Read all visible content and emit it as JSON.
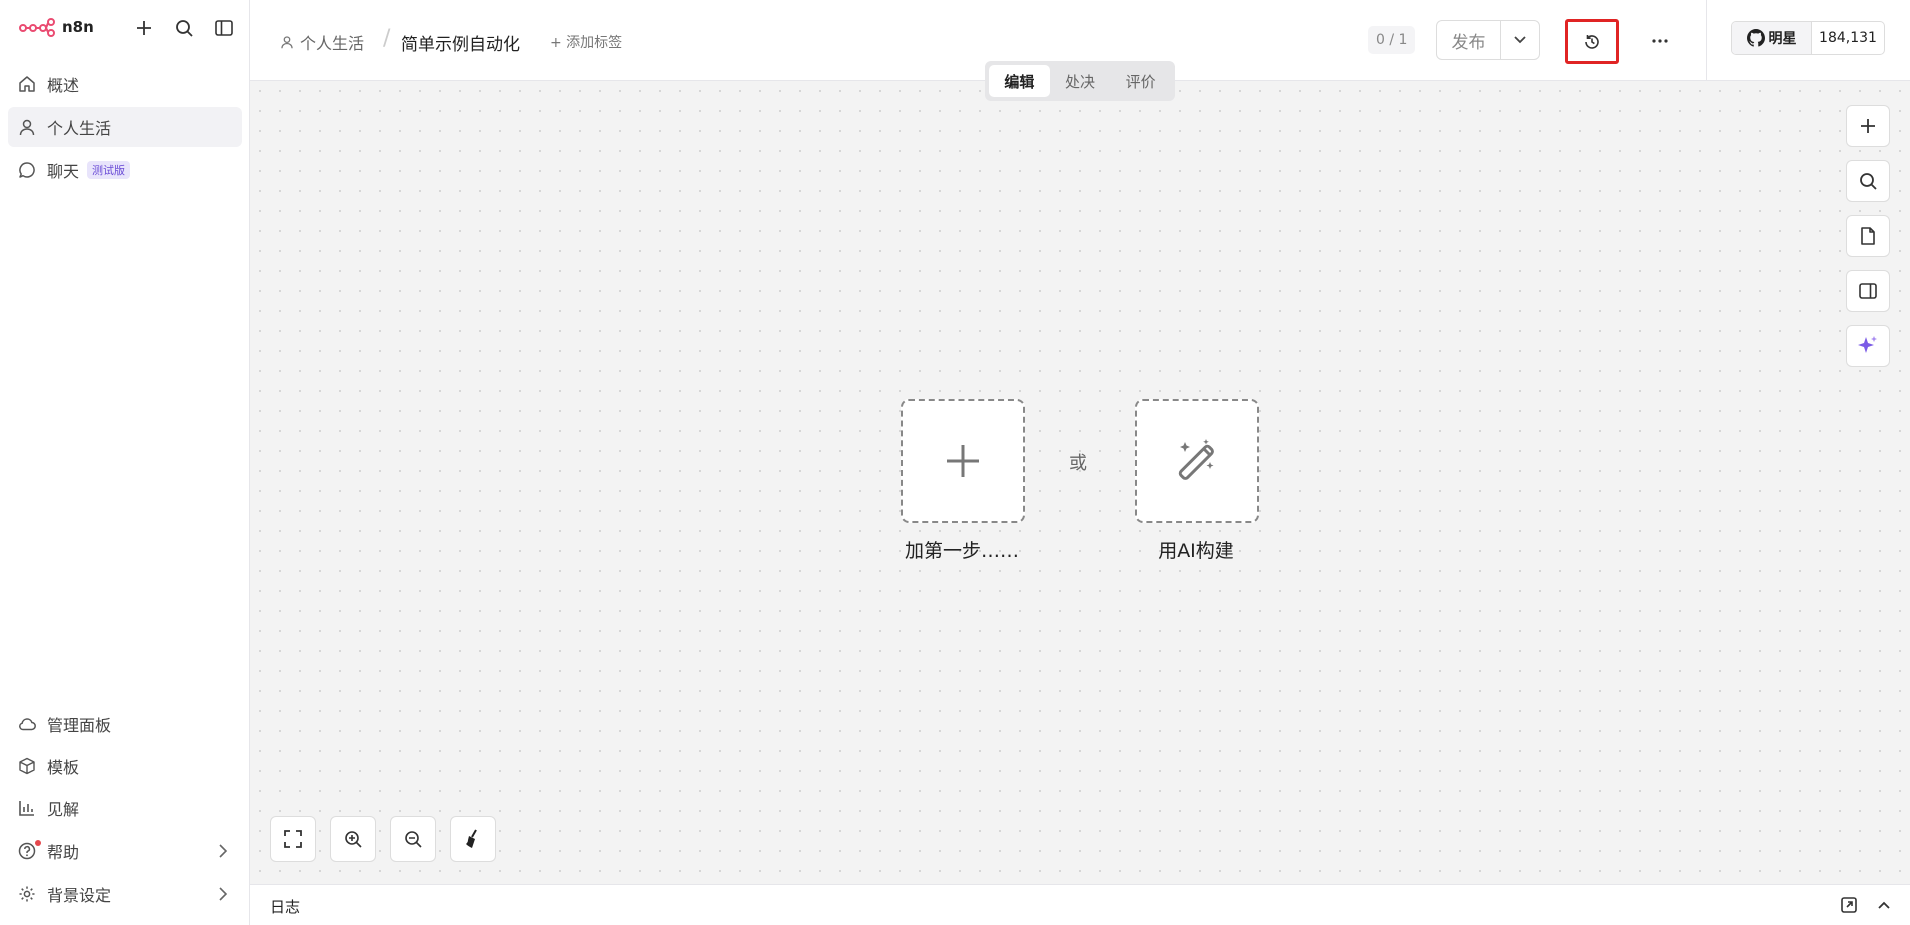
{
  "sidebar": {
    "logo_text": "n8n",
    "nav": [
      {
        "label": "概述",
        "icon": "home-icon"
      },
      {
        "label": "个人生活",
        "icon": "user-icon"
      },
      {
        "label": "聊天",
        "icon": "chat-icon",
        "badge": "测试版"
      }
    ],
    "bottom": [
      {
        "label": "管理面板",
        "icon": "cloud-icon"
      },
      {
        "label": "模板",
        "icon": "box-icon"
      },
      {
        "label": "见解",
        "icon": "bar-chart-icon"
      },
      {
        "label": "帮助",
        "icon": "help-icon"
      },
      {
        "label": "背景设定",
        "icon": "gear-icon"
      }
    ]
  },
  "header": {
    "project": "个人生活",
    "separator": "/",
    "workflow_name": "简单示例自动化",
    "add_tag": "+ 添加标签",
    "counter": "0 / 1",
    "publish_label": "发布",
    "github_star": "明星",
    "github_count": "184,131"
  },
  "canvas": {
    "tabs": [
      "编辑",
      "处决",
      "评价"
    ],
    "add_first_step": "加第一步……",
    "or": "或",
    "build_with_ai": "用AI构建"
  },
  "logs": {
    "title": "日志"
  },
  "colors": {
    "highlight": "#e02424",
    "accent_purple": "#7b5be6",
    "logo_pink": "#ea4b71"
  }
}
